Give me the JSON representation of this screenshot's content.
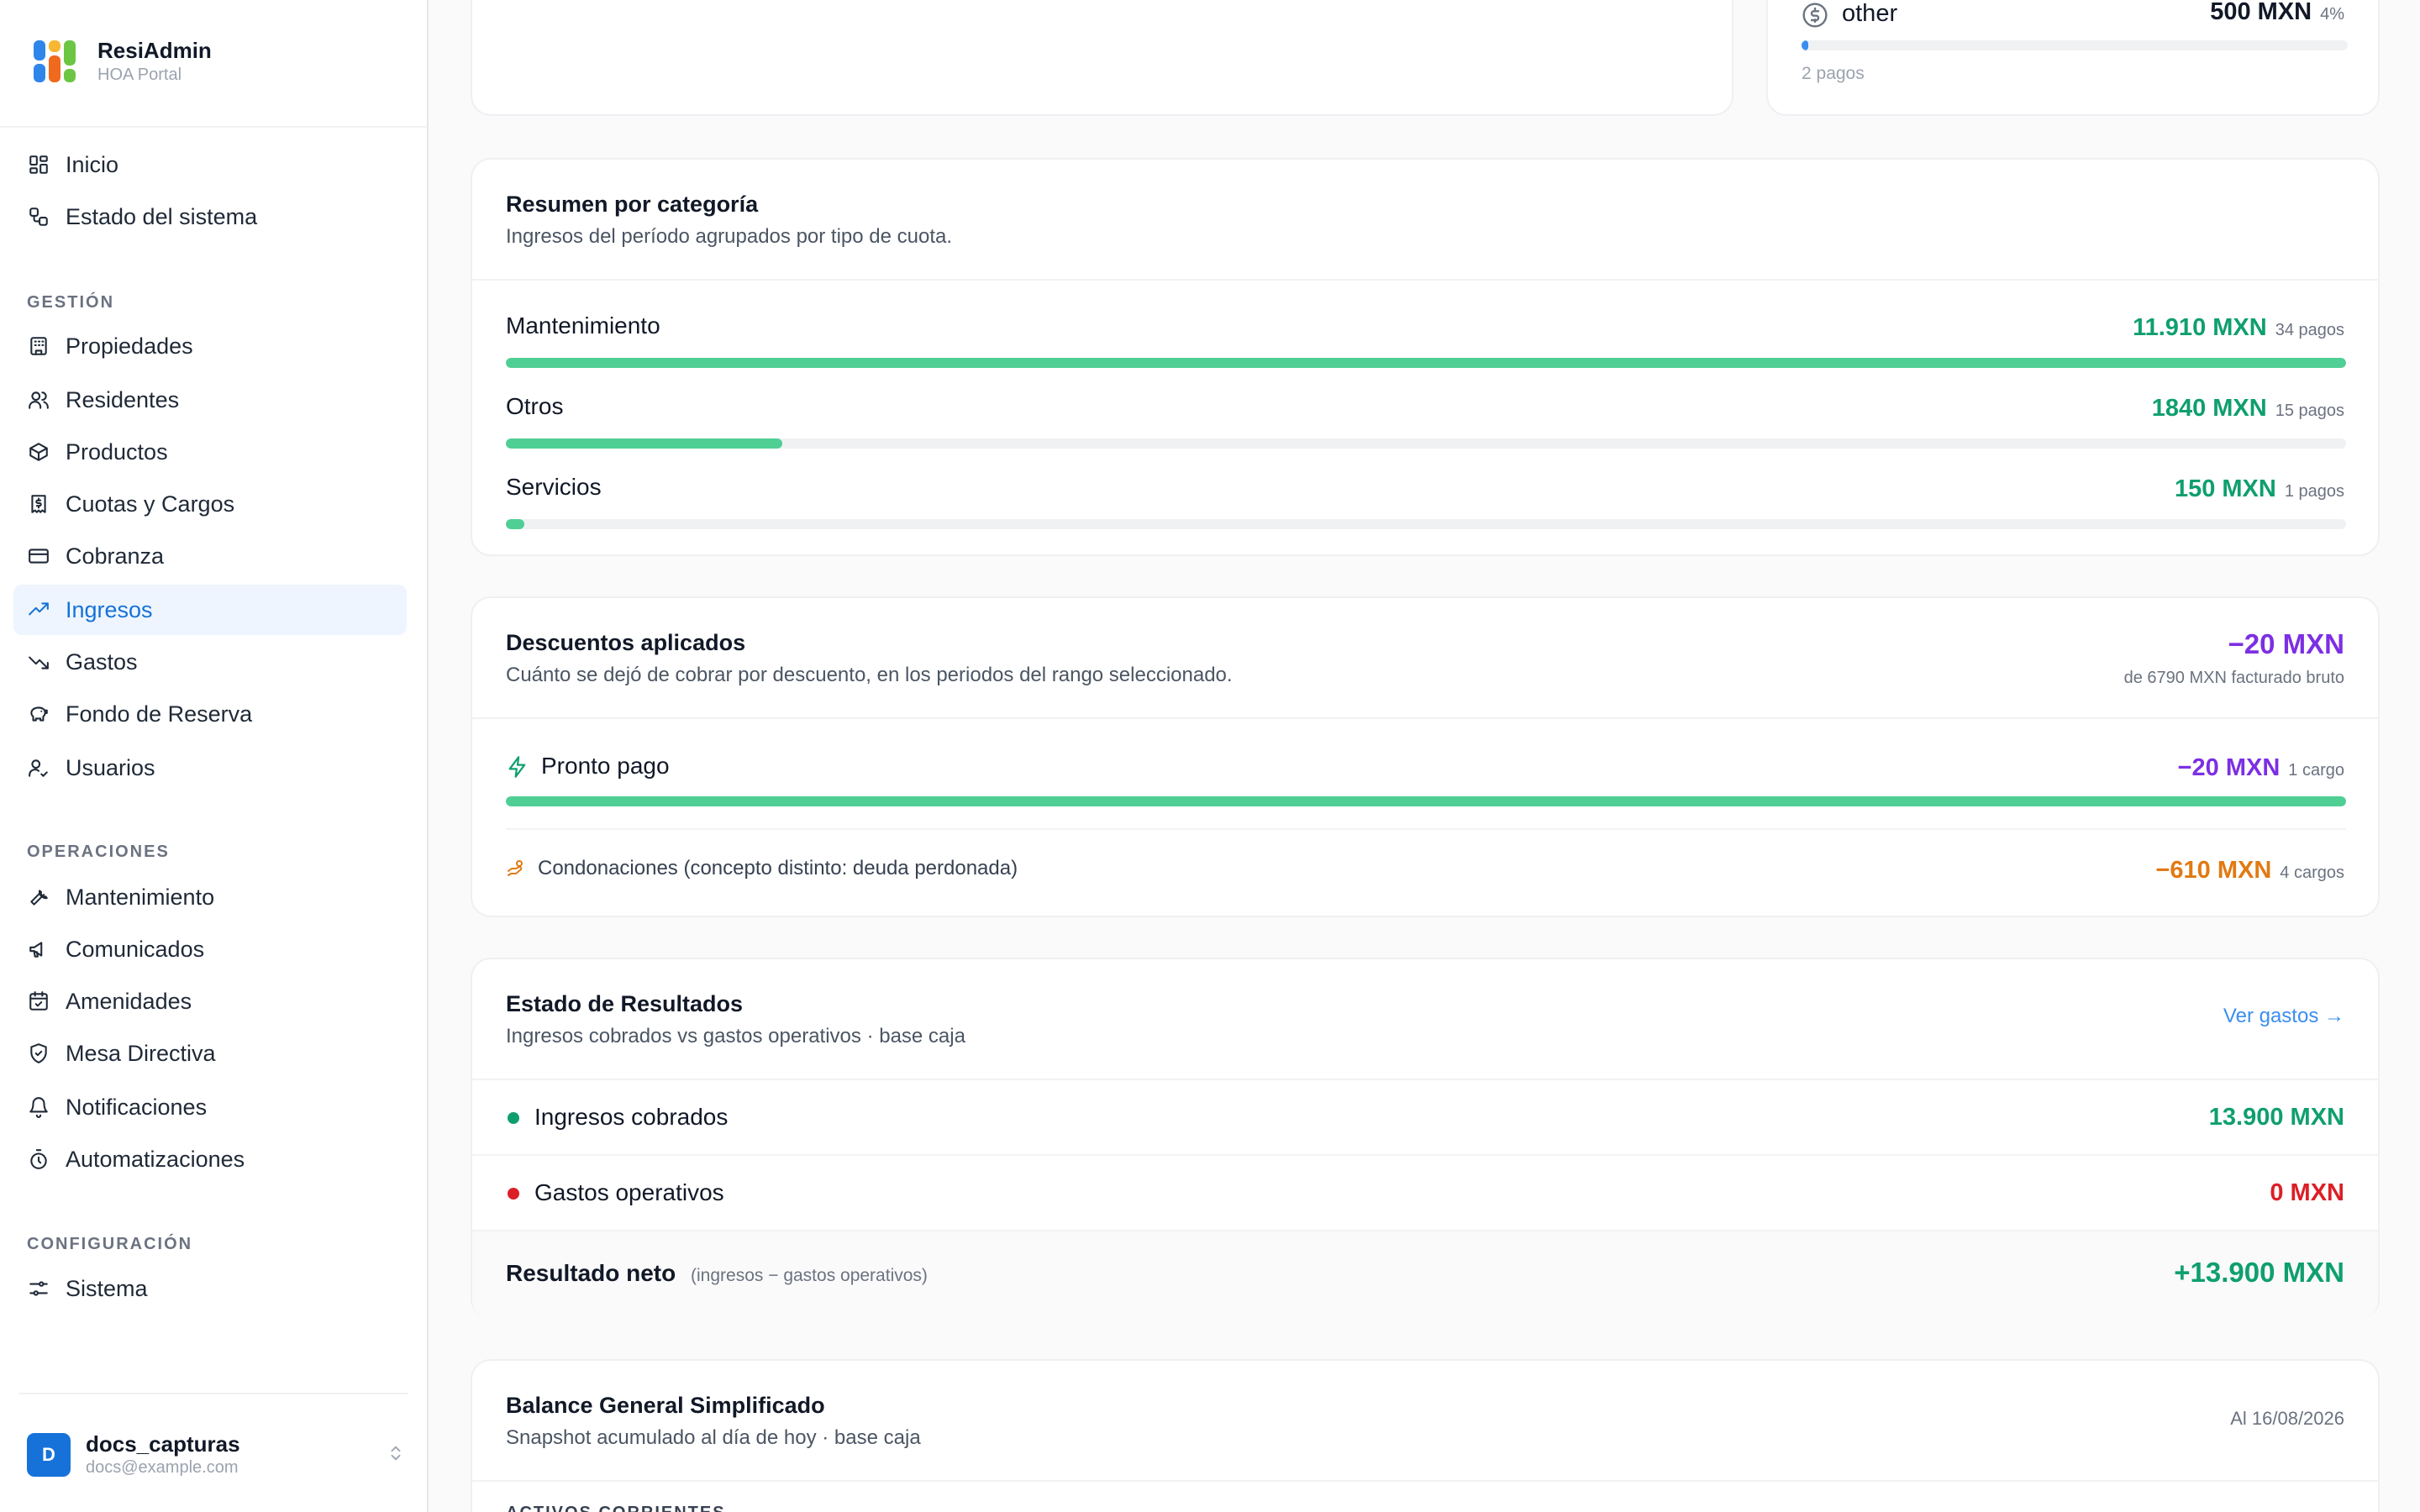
{
  "app": {
    "name": "ResiAdmin",
    "subtitle": "HOA Portal"
  },
  "nav": {
    "top": [
      {
        "label": "Inicio",
        "icon": "dashboard-icon"
      },
      {
        "label": "Estado del sistema",
        "icon": "status-icon"
      }
    ],
    "sections": [
      {
        "label": "GESTIÓN",
        "items": [
          {
            "label": "Propiedades",
            "icon": "building-icon"
          },
          {
            "label": "Residentes",
            "icon": "users-icon"
          },
          {
            "label": "Productos",
            "icon": "box-icon"
          },
          {
            "label": "Cuotas y Cargos",
            "icon": "receipt-icon"
          },
          {
            "label": "Cobranza",
            "icon": "credit-card-icon"
          },
          {
            "label": "Ingresos",
            "icon": "trending-up-icon",
            "active": true
          },
          {
            "label": "Gastos",
            "icon": "trending-down-icon"
          },
          {
            "label": "Fondo de Reserva",
            "icon": "piggy-bank-icon"
          },
          {
            "label": "Usuarios",
            "icon": "user-check-icon"
          }
        ]
      },
      {
        "label": "OPERACIONES",
        "items": [
          {
            "label": "Mantenimiento",
            "icon": "wrench-icon"
          },
          {
            "label": "Comunicados",
            "icon": "megaphone-icon"
          },
          {
            "label": "Amenidades",
            "icon": "calendar-icon"
          },
          {
            "label": "Mesa Directiva",
            "icon": "shield-icon"
          },
          {
            "label": "Notificaciones",
            "icon": "bell-icon"
          },
          {
            "label": "Automatizaciones",
            "icon": "timer-icon"
          }
        ]
      },
      {
        "label": "CONFIGURACIÓN",
        "items": [
          {
            "label": "Sistema",
            "icon": "sliders-icon"
          }
        ]
      }
    ]
  },
  "user": {
    "initial": "D",
    "name": "docs_capturas",
    "email": "docs@example.com"
  },
  "method_card": {
    "label": "other",
    "amount": "500 MXN",
    "percent": "4%",
    "count": "2 pagos",
    "bar_fraction": 0.012
  },
  "category": {
    "title": "Resumen por categoría",
    "subtitle": "Ingresos del período agrupados por tipo de cuota.",
    "rows": [
      {
        "label": "Mantenimiento",
        "amount": "11.910 MXN",
        "count": "34 pagos",
        "fraction": 1.0
      },
      {
        "label": "Otros",
        "amount": "1840 MXN",
        "count": "15 pagos",
        "fraction": 0.15
      },
      {
        "label": "Servicios",
        "amount": "150 MXN",
        "count": "1 pagos",
        "fraction": 0.01
      }
    ]
  },
  "discounts": {
    "title": "Descuentos aplicados",
    "subtitle": "Cuánto se dejó de cobrar por descuento, en los periodos del rango seleccionado.",
    "total": "−20 MXN",
    "total_note": "de 6790 MXN facturado bruto",
    "row": {
      "label": "Pronto pago",
      "amount": "−20 MXN",
      "count": "1 cargo",
      "fraction": 1.0
    },
    "condonaciones": {
      "label": "Condonaciones (concepto distinto: deuda perdonada)",
      "amount": "−610 MXN",
      "count": "4 cargos"
    }
  },
  "results": {
    "title": "Estado de Resultados",
    "subtitle": "Ingresos cobrados vs gastos operativos · base caja",
    "link": "Ver gastos →",
    "income": {
      "label": "Ingresos cobrados",
      "amount": "13.900 MXN"
    },
    "expenses": {
      "label": "Gastos operativos",
      "amount": "0 MXN"
    },
    "net": {
      "label": "Resultado neto",
      "note": "(ingresos − gastos operativos)",
      "amount": "+13.900 MXN"
    }
  },
  "balance": {
    "title": "Balance General Simplificado",
    "subtitle": "Snapshot acumulado al día de hoy · base caja",
    "date": "Al 16/08/2026",
    "section": "ACTIVOS CORRIENTES"
  },
  "colors": {
    "accent": "#1672d9",
    "green": "#0f9f6e",
    "bar_green": "#4fcf94",
    "purple": "#7c2fe3",
    "orange": "#e17a12",
    "red": "#dc1f26"
  }
}
